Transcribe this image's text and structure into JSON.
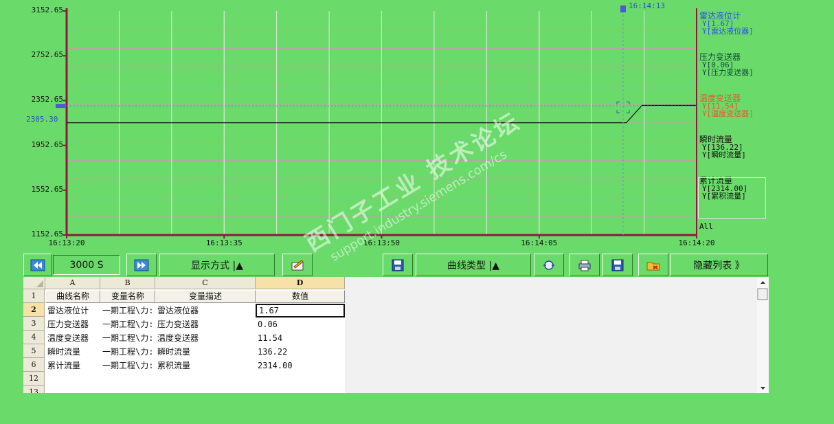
{
  "chart_data": {
    "type": "line",
    "y_ticks": [
      "3152.65",
      "2752.65",
      "2352.65",
      "1952.65",
      "1552.65",
      "1152.65"
    ],
    "ylim": [
      1152.65,
      3152.65
    ],
    "x_ticks": [
      "16:13:20",
      "16:13:35",
      "16:13:50",
      "16:14:05",
      "16:14:20"
    ],
    "xlim_seconds": [
      0,
      60
    ],
    "grid": true,
    "left_marker_value": "2305.30",
    "cursor_time": "16:14:13",
    "series": [
      {
        "name": "温度变送器",
        "x_seconds": [
          0,
          53.3,
          54.8,
          60
        ],
        "values": [
          2155,
          2155,
          2310,
          2310
        ]
      }
    ]
  },
  "legend": {
    "items": [
      {
        "name": "雷达液位计",
        "value": "Y[1.67]",
        "label": "Y[雷达液位器]",
        "color": "#2a50e8"
      },
      {
        "name": "压力变送器",
        "value": "Y[0.06]",
        "label": "Y[压力变送器]",
        "color": "#124a3a"
      },
      {
        "name": "温度变送器",
        "value": "Y[11.54]",
        "label": "Y[温度变送器]",
        "color": "#ea5a2a"
      },
      {
        "name": "瞬时流量",
        "value": "Y[136.22]",
        "label": "Y[瞬时流量]",
        "color": "#111111"
      },
      {
        "name": "累计流量",
        "value": "Y[2314.00]",
        "label": "Y[累积流量]",
        "color": "#111111"
      }
    ],
    "all_label": "All"
  },
  "toolbar": {
    "time_span": "3000 S",
    "display_mode_label": "显示方式 |▲",
    "curve_type_label": "曲线类型 |▲",
    "hide_list_label": "隐藏列表 》"
  },
  "table": {
    "col_letters": [
      "A",
      "B",
      "C",
      "D"
    ],
    "headers": [
      "曲线名称",
      "变量名称",
      "变量描述",
      "数值"
    ],
    "row_numbers": [
      "1",
      "2",
      "3",
      "4",
      "5",
      "6",
      "12",
      "13"
    ],
    "rows": [
      [
        "雷达液位计",
        "一期工程\\力:",
        "雷达液位器",
        "1.67"
      ],
      [
        "压力变送器",
        "一期工程\\力:",
        "压力变送器",
        "0.06"
      ],
      [
        "温度变送器",
        "一期工程\\力:",
        "温度变送器",
        "11.54"
      ],
      [
        "瞬时流量",
        "一期工程\\力:",
        "瞬时流量",
        "136.22"
      ],
      [
        "累计流量",
        "一期工程\\力:",
        "累积流量",
        "2314.00"
      ]
    ]
  },
  "watermark": {
    "cn": "西门子工业 技术论坛",
    "url": "support.industry.siemens.com/cs"
  }
}
